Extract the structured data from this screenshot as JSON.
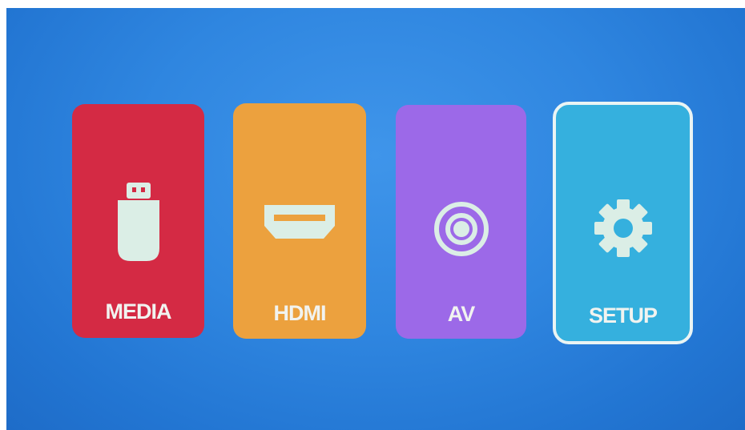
{
  "menu": {
    "selected": "setup",
    "tiles": [
      {
        "id": "media",
        "label": "MEDIA",
        "icon": "usb-drive-icon",
        "color": "#d42a44"
      },
      {
        "id": "hdmi",
        "label": "HDMI",
        "icon": "hdmi-port-icon",
        "color": "#eca13e"
      },
      {
        "id": "av",
        "label": "AV",
        "icon": "av-input-icon",
        "color": "#9c69e8"
      },
      {
        "id": "setup",
        "label": "SETUP",
        "icon": "gear-icon",
        "color": "#35b0de"
      }
    ]
  },
  "colors": {
    "background": "#2f86e0",
    "icon_fill": "#dbeee6",
    "selection_border": "#eaf4f4"
  }
}
